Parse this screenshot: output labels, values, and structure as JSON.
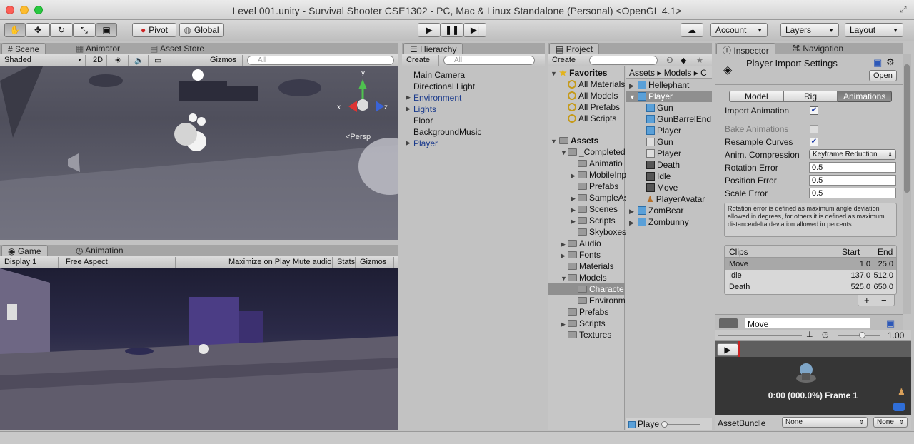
{
  "window": {
    "title": "Level 001.unity - Survival Shooter CSE1302 - PC, Mac & Linux Standalone (Personal) <OpenGL 4.1>"
  },
  "toolbar": {
    "pivot": "Pivot",
    "global": "Global",
    "account": "Account",
    "layers": "Layers",
    "layout": "Layout"
  },
  "scene": {
    "tabs": [
      "Scene",
      "Animator",
      "Asset Store"
    ],
    "shading": "Shaded",
    "mode2d": "2D",
    "gizmos": "Gizmos",
    "search_placeholder": "All",
    "persp": "<Persp",
    "axis_y": "y",
    "axis_x": "x",
    "axis_z": "z"
  },
  "game": {
    "tabs": [
      "Game",
      "Animation"
    ],
    "display": "Display 1",
    "aspect": "Free Aspect",
    "maximize": "Maximize on Play",
    "mute": "Mute audio",
    "stats": "Stats",
    "gizmos": "Gizmos"
  },
  "hierarchy": {
    "tab": "Hierarchy",
    "create": "Create",
    "search_placeholder": "All",
    "items": [
      "Main Camera",
      "Directional Light",
      "Environment",
      "Lights",
      "Floor",
      "BackgroundMusic",
      "Player"
    ]
  },
  "project": {
    "tab": "Project",
    "create": "Create",
    "favorites_label": "Favorites",
    "favorites": [
      "All Materials",
      "All Models",
      "All Prefabs",
      "All Scripts"
    ],
    "assets_label": "Assets",
    "tree": [
      "_Completed",
      "Animatio",
      "MobileInp",
      "Prefabs",
      "SampleAs",
      "Scenes",
      "Scripts",
      "Skyboxes",
      "Audio",
      "Fonts",
      "Materials",
      "Models",
      "Characte",
      "Environm",
      "Prefabs",
      "Scripts",
      "Textures"
    ],
    "breadcrumb": [
      "Assets",
      "Models",
      "C"
    ],
    "files": [
      "Hellephant",
      "Player",
      "Gun",
      "GunBarrelEnd",
      "Player",
      "Gun",
      "Player",
      "Death",
      "Idle",
      "Move",
      "PlayerAvatar",
      "ZomBear",
      "Zombunny"
    ],
    "footer_label": "Playe"
  },
  "inspector": {
    "tabs": [
      "Inspector",
      "Navigation"
    ],
    "title": "Player Import Settings",
    "open": "Open",
    "subtabs": [
      "Model",
      "Rig",
      "Animations"
    ],
    "rows": {
      "import_animation": "Import Animation",
      "bake_animations": "Bake Animations",
      "resample_curves": "Resample Curves",
      "anim_compression": "Anim. Compression",
      "rotation_error": "Rotation Error",
      "position_error": "Position Error",
      "scale_error": "Scale Error"
    },
    "compression_value": "Keyframe Reduction",
    "rotation_error_value": "0.5",
    "position_error_value": "0.5",
    "scale_error_value": "0.5",
    "help_text": "Rotation error is defined as maximum angle deviation allowed in degrees, for others it is defined as maximum distance/delta deviation allowed in percents",
    "clips": {
      "headers": [
        "Clips",
        "Start",
        "End"
      ],
      "rows": [
        [
          "Move",
          "1.0",
          "25.0"
        ],
        [
          "Idle",
          "137.0",
          "512.0"
        ],
        [
          "Death",
          "525.0",
          "650.0"
        ]
      ]
    },
    "clip_name": "Move",
    "speed": "1.00",
    "preview_time": "0:00 (000.0%) Frame 1",
    "assetbundle_label": "AssetBundle",
    "assetbundle_value": "None",
    "assetbundle_variant": "None"
  },
  "colors": {
    "accent_blue": "#3b6fb8",
    "selected": "#8a9cc0"
  }
}
